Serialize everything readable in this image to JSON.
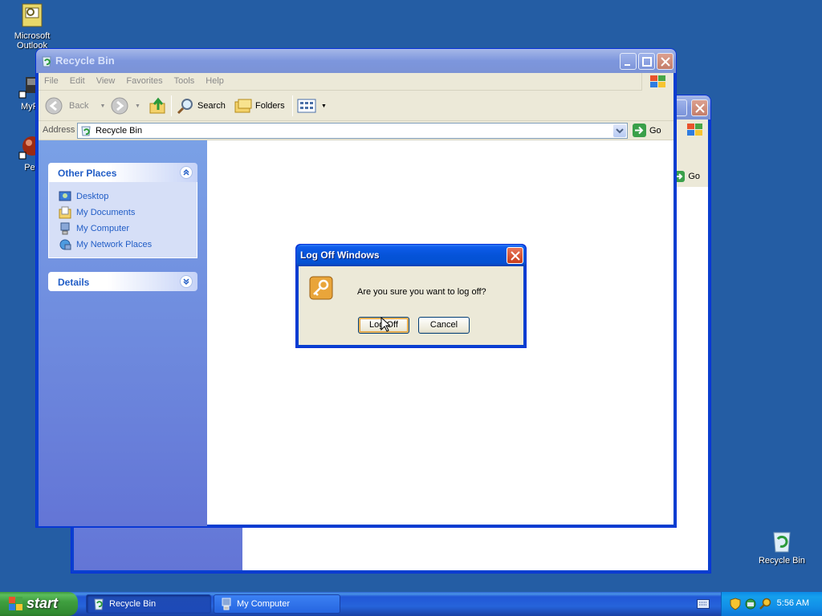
{
  "desktop": {
    "icons": [
      {
        "label": "Microsoft Outlook"
      },
      {
        "label": "MyPa"
      },
      {
        "label": "Peg"
      },
      {
        "label": "Recycle Bin"
      }
    ]
  },
  "back_window": {
    "go_label": "Go"
  },
  "explorer": {
    "title": "Recycle Bin",
    "menu": [
      "File",
      "Edit",
      "View",
      "Favorites",
      "Tools",
      "Help"
    ],
    "toolbar": {
      "back_label": "Back",
      "search_label": "Search",
      "folders_label": "Folders"
    },
    "address": {
      "label": "Address",
      "value": "Recycle Bin",
      "go_label": "Go"
    },
    "other_places": {
      "title": "Other Places",
      "links": [
        "Desktop",
        "My Documents",
        "My Computer",
        "My Network Places"
      ]
    },
    "details": {
      "title": "Details"
    }
  },
  "dialog": {
    "title": "Log Off Windows",
    "message": "Are you sure you want to log off?",
    "log_off_label": "Log Off",
    "cancel_label": "Cancel"
  },
  "taskbar": {
    "start_label": "start",
    "tasks": [
      "Recycle Bin",
      "My Computer"
    ],
    "clock": "5:56 AM"
  },
  "colors": {
    "desktop": "#245da4",
    "titlebar": "#0553d8",
    "task_pane_link": "#215dc6"
  }
}
